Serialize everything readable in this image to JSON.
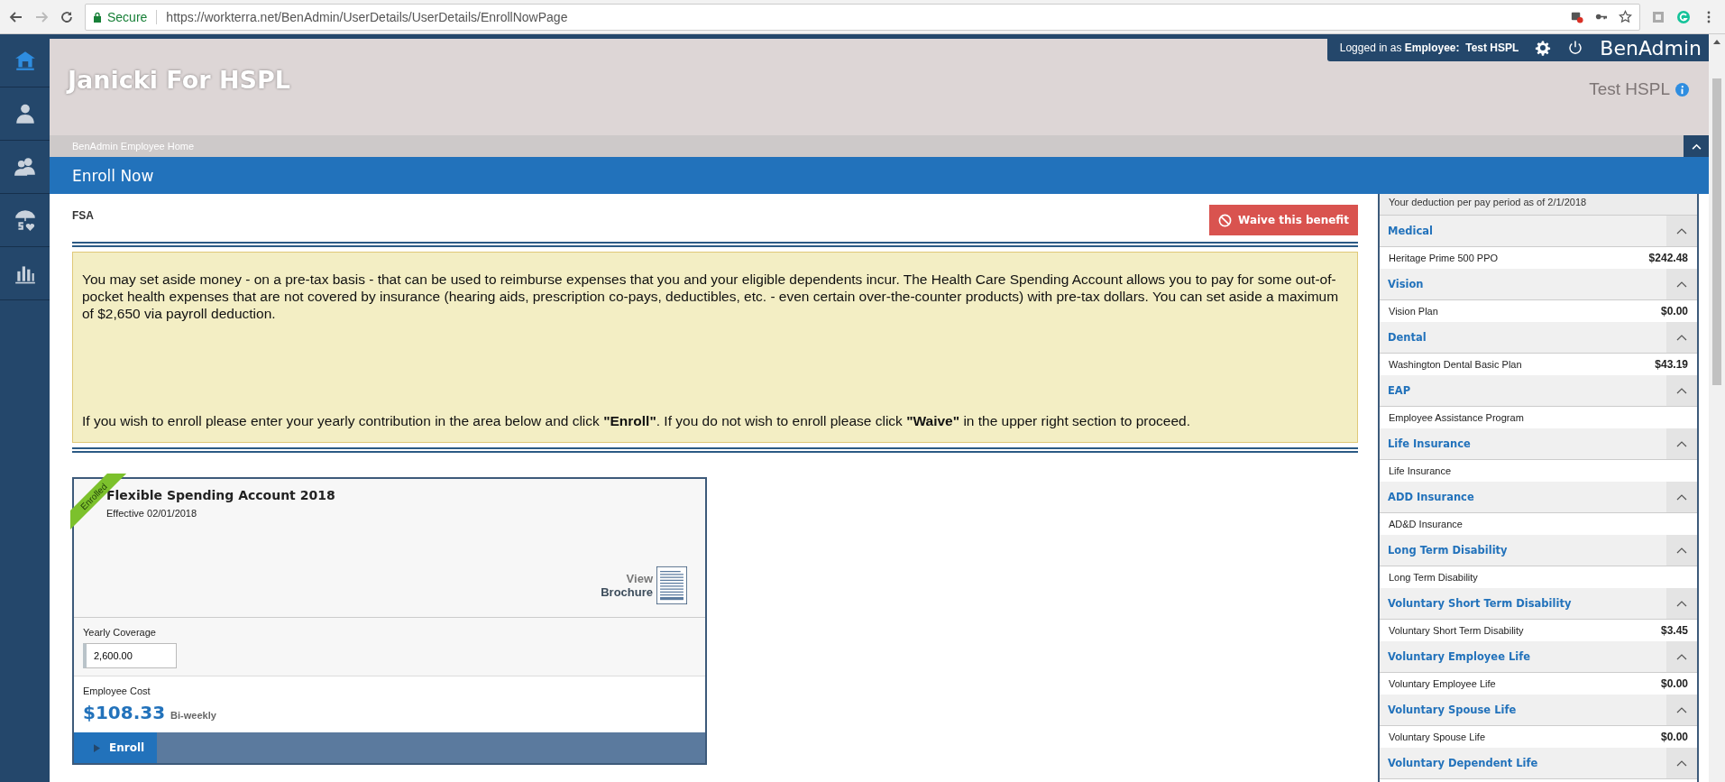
{
  "browser": {
    "secure_label": "Secure",
    "url": "https://workterra.net/BenAdmin/UserDetails/UserDetails/EnrollNowPage"
  },
  "nav": [
    {
      "kind": "home",
      "selected": true
    },
    {
      "kind": "person",
      "selected": false
    },
    {
      "kind": "people",
      "selected": false
    },
    {
      "kind": "umbrella",
      "selected": false
    },
    {
      "kind": "chart",
      "selected": false
    }
  ],
  "header": {
    "title": "Janicki For HSPL",
    "logged_in_prefix": "Logged in as",
    "role": "Employee:",
    "user": "Test HSPL",
    "app_name": "BenAdmin",
    "account": "Test HSPL"
  },
  "breadcrumb": "BenAdmin Employee Home",
  "page_title": "Enroll Now",
  "benefit": {
    "name": "FSA",
    "waive_label": "Waive this benefit",
    "paragraphs": [
      "You may set aside money - on a pre-tax basis - that can be used to reimburse expenses that you and your eligible dependents incur. The Health Care Spending Account allows you to pay for some out-of-pocket health expenses that are not covered by insurance (hearing aids, prescription co-pays, deductibles, etc. - even certain over-the-counter products) with pre-tax dollars. You can set aside a maximum of $2,650 via payroll deduction.",
      "If you wish to enroll please enter your yearly contribution in the area below and click **\"Enroll\"**. If you do not wish to enroll please click **\"Waive\"** in the upper right section to proceed."
    ]
  },
  "plan_card": {
    "ribbon": "Enrolled",
    "title": "Flexible Spending Account 2018",
    "effective": "Effective 02/01/2018",
    "brochure_view": "View",
    "brochure_label": "Brochure",
    "coverage_label": "Yearly Coverage",
    "coverage_value": "2,600.00",
    "cost_label": "Employee Cost",
    "cost": "$108.33",
    "frequency": "Bi-weekly",
    "enroll_label": "Enroll"
  },
  "deductions": {
    "note": "Your deduction per pay period as of 2/1/2018",
    "sections": [
      {
        "title": "Medical",
        "expanded": true,
        "items": [
          {
            "name": "Heritage Prime 500 PPO",
            "amount": "$242.48"
          }
        ]
      },
      {
        "title": "Vision",
        "expanded": true,
        "items": [
          {
            "name": "Vision Plan",
            "amount": "$0.00"
          }
        ]
      },
      {
        "title": "Dental",
        "expanded": true,
        "items": [
          {
            "name": "Washington Dental Basic Plan",
            "amount": "$43.19"
          }
        ]
      },
      {
        "title": "EAP",
        "expanded": true,
        "items": [
          {
            "name": "Employee Assistance Program"
          }
        ]
      },
      {
        "title": "Life Insurance",
        "expanded": true,
        "items": [
          {
            "name": "Life Insurance"
          }
        ]
      },
      {
        "title": "ADD Insurance",
        "expanded": true,
        "items": [
          {
            "name": "AD&D Insurance"
          }
        ]
      },
      {
        "title": "Long Term Disability",
        "expanded": true,
        "items": [
          {
            "name": "Long Term Disability"
          }
        ]
      },
      {
        "title": "Voluntary Short Term Disability",
        "expanded": true,
        "items": [
          {
            "name": "Voluntary Short Term Disability",
            "amount": "$3.45"
          }
        ]
      },
      {
        "title": "Voluntary Employee Life",
        "expanded": true,
        "items": [
          {
            "name": "Voluntary Employee Life",
            "amount": "$0.00"
          }
        ]
      },
      {
        "title": "Voluntary Spouse Life",
        "expanded": true,
        "items": [
          {
            "name": "Voluntary Spouse Life",
            "amount": "$0.00"
          }
        ]
      },
      {
        "title": "Voluntary Dependent Life",
        "expanded": true
      }
    ]
  }
}
